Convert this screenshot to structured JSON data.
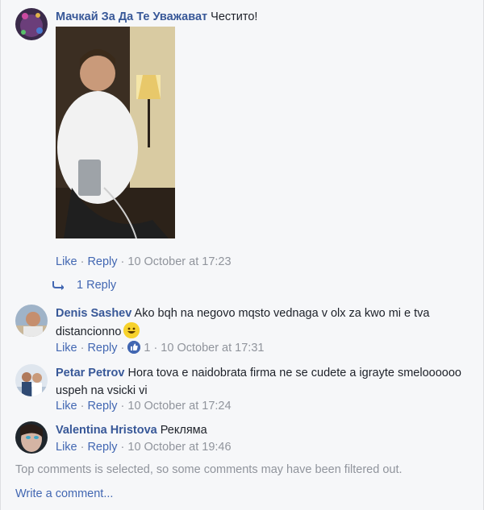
{
  "comments": [
    {
      "author": "Мачкай За Да Те Уважават",
      "text": "Честито!",
      "actions": {
        "like": "Like",
        "reply": "Reply",
        "time": "10 October at 17:23"
      },
      "replies_label": "1 Reply"
    },
    {
      "author": "Denis Sashev",
      "text": "Ako bqh na negovo mqsto vednaga v olx za kwo mi e tva distancionno",
      "actions": {
        "like": "Like",
        "reply": "Reply",
        "reaction_count": "1",
        "time": "10 October at 17:31"
      }
    },
    {
      "author": "Petar Petrov",
      "text": "Hora tova e naidobrata firma ne se cudete a igrayte smeloooooo uspeh na vsicki vi",
      "actions": {
        "like": "Like",
        "reply": "Reply",
        "time": "10 October at 17:24"
      }
    },
    {
      "author": "Valentina Hristova",
      "text": "Реклямa",
      "actions": {
        "like": "Like",
        "reply": "Reply",
        "time": "10 October at 19:46"
      }
    }
  ],
  "footer": {
    "filter_note": "Top comments is selected, so some comments may have been filtered out.",
    "write_comment": "Write a comment..."
  },
  "colors": {
    "link": "#4267b2",
    "author": "#385898",
    "meta": "#90949c",
    "background": "#f6f7f9"
  }
}
